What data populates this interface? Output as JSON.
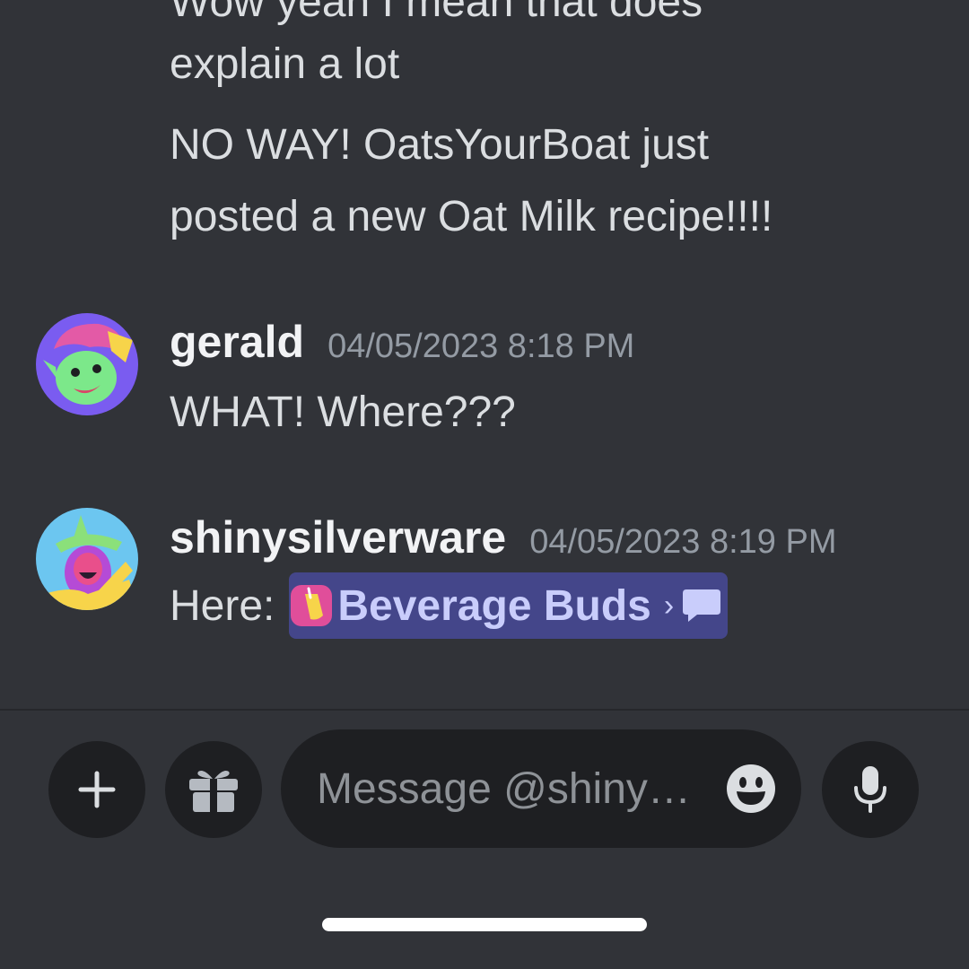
{
  "messages": {
    "prev_lines": [
      "Wow yeah I mean that does",
      "explain a lot",
      "NO WAY! OatsYourBoat just",
      "posted a new Oat Milk recipe!!!!"
    ],
    "gerald": {
      "username": "gerald",
      "timestamp": "04/05/2023 8:18 PM",
      "text": "WHAT! Where???"
    },
    "shiny": {
      "username": "shinysilverware",
      "timestamp": "04/05/2023 8:19 PM",
      "text": "Here:",
      "mention": "Beverage Buds",
      "mention_arrow": "›"
    }
  },
  "composer": {
    "placeholder": "Message @shiny…",
    "add_icon": "plus-icon",
    "gift_icon": "gift-icon",
    "emoji_icon": "emoji-smile-icon",
    "mic_icon": "microphone-icon"
  },
  "colors": {
    "background": "#313338",
    "input_bg": "#1e1f22",
    "mention_bg": "#44468a",
    "mention_text": "#c9cdfb",
    "channel_icon": "#e04e9a"
  }
}
